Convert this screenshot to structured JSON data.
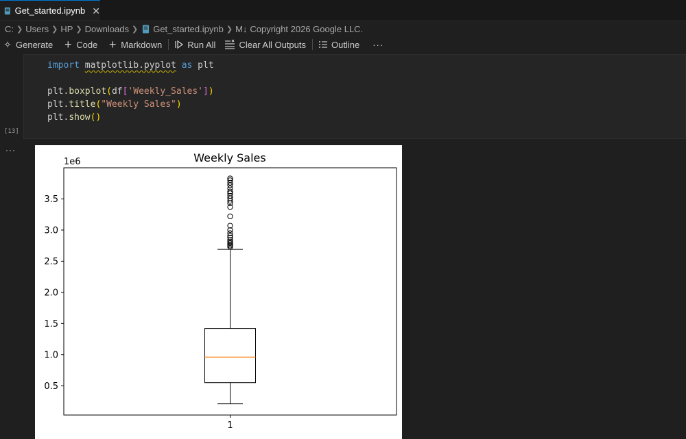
{
  "tab": {
    "label": "Get_started.ipynb",
    "icon": "notebook-file-icon",
    "close_icon": "close-icon"
  },
  "breadcrumb": {
    "items": [
      "C:",
      "Users",
      "HP",
      "Downloads",
      "Get_started.ipynb",
      "Copyright 2026 Google LLC."
    ],
    "markdown_badge": "M↓"
  },
  "toolbar": {
    "generate": "Generate",
    "code": "Code",
    "markdown": "Markdown",
    "run_all": "Run All",
    "clear_all_outputs": "Clear All Outputs",
    "outline": "Outline",
    "more": "···"
  },
  "cell": {
    "execution_count": "[13]",
    "code_lines": [
      "import matplotlib.pyplot as plt",
      "",
      "plt.boxplot(df['Weekly_Sales'])",
      "plt.title(\"Weekly Sales\")",
      "plt.show()"
    ],
    "output_more": "···"
  },
  "chart_data": {
    "type": "boxplot",
    "title": "Weekly Sales",
    "xlabel": "",
    "ylabel": "",
    "y_offset_label": "1e6",
    "categories": [
      "1"
    ],
    "yticks": [
      "0.5",
      "1.0",
      "1.5",
      "2.0",
      "2.5",
      "3.0",
      "3.5"
    ],
    "ylim": [
      0.03,
      4.0
    ],
    "box": {
      "whisker_low": 0.21,
      "q1": 0.55,
      "median": 0.96,
      "q3": 1.42,
      "whisker_high": 2.69
    },
    "outliers": [
      2.73,
      2.75,
      2.77,
      2.79,
      2.81,
      2.84,
      2.88,
      2.91,
      2.95,
      3.0,
      3.07,
      3.22,
      3.37,
      3.43,
      3.47,
      3.51,
      3.55,
      3.59,
      3.62,
      3.67,
      3.72,
      3.76,
      3.8,
      3.83
    ],
    "colors": {
      "median": "#ff7f0e",
      "box": "#000000"
    }
  }
}
